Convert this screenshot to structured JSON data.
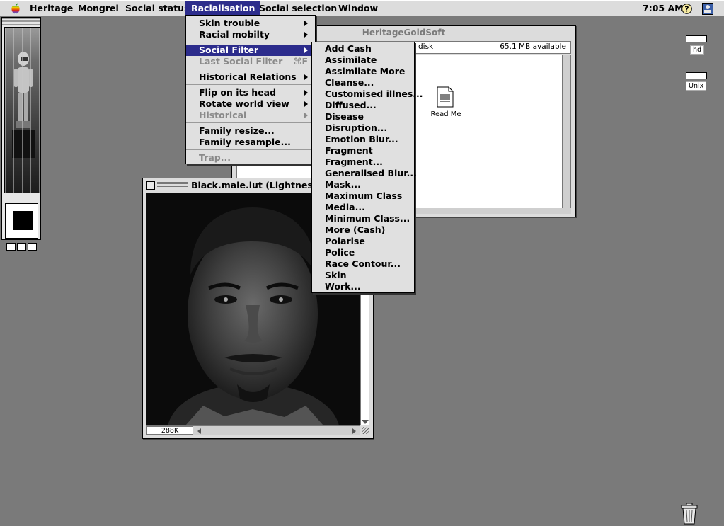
{
  "menubar": {
    "menus": [
      "Heritage",
      "Mongrel",
      "Social status",
      "Racialisation",
      "Social selection",
      "Window"
    ],
    "active_menu": "Racialisation",
    "clock": "7:05 AM",
    "icons": [
      "apple-icon",
      "help-icon",
      "application-icon"
    ]
  },
  "racialisation_menu": {
    "items": [
      {
        "label": "Skin trouble",
        "submenu": true
      },
      {
        "label": "Racial mobilty",
        "submenu": true
      },
      {
        "label": "Social Filter",
        "submenu": true,
        "highlighted": true
      },
      {
        "label": "Last Social Filter",
        "shortcut": "⌘F",
        "disabled": true
      },
      {
        "label": "Historical Relations",
        "submenu": true
      },
      {
        "label": "Flip on its head",
        "submenu": true
      },
      {
        "label": "Rotate world view",
        "submenu": true
      },
      {
        "label": "Historical",
        "submenu": true,
        "disabled": true
      },
      {
        "label": "Family resize..."
      },
      {
        "label": "Family resample..."
      },
      {
        "label": "Trap...",
        "disabled": true
      }
    ]
  },
  "social_filter_menu": {
    "items": [
      "Add Cash",
      "Assimilate",
      "Assimilate More",
      "Cleanse...",
      "Customised illnes...",
      "Diffused...",
      "Disease",
      "Disruption...",
      "Emotion Blur...",
      "Fragment",
      "Fragment...",
      "Generalised Blur...",
      "Mask...",
      "Maximum Class",
      "Media...",
      "Minimum Class...",
      "More (Cash)",
      "Polarise",
      "Police",
      "Race Contour...",
      "Skin",
      "Work..."
    ]
  },
  "finder_window": {
    "title": "HeritageGoldSoft",
    "disk_label": "disk",
    "available": "65.1 MB available",
    "file_label": "Read Me"
  },
  "image_window": {
    "title": "Black.male.lut  (Lightness,",
    "size_readout": "288K"
  },
  "desktop": {
    "icons": [
      {
        "label": "hd"
      },
      {
        "label": "Unix"
      }
    ]
  },
  "colors": {
    "menu_highlight": "#2c2c8c",
    "menu_background": "#e0e0e0",
    "desktop": "#7f7f7f"
  }
}
